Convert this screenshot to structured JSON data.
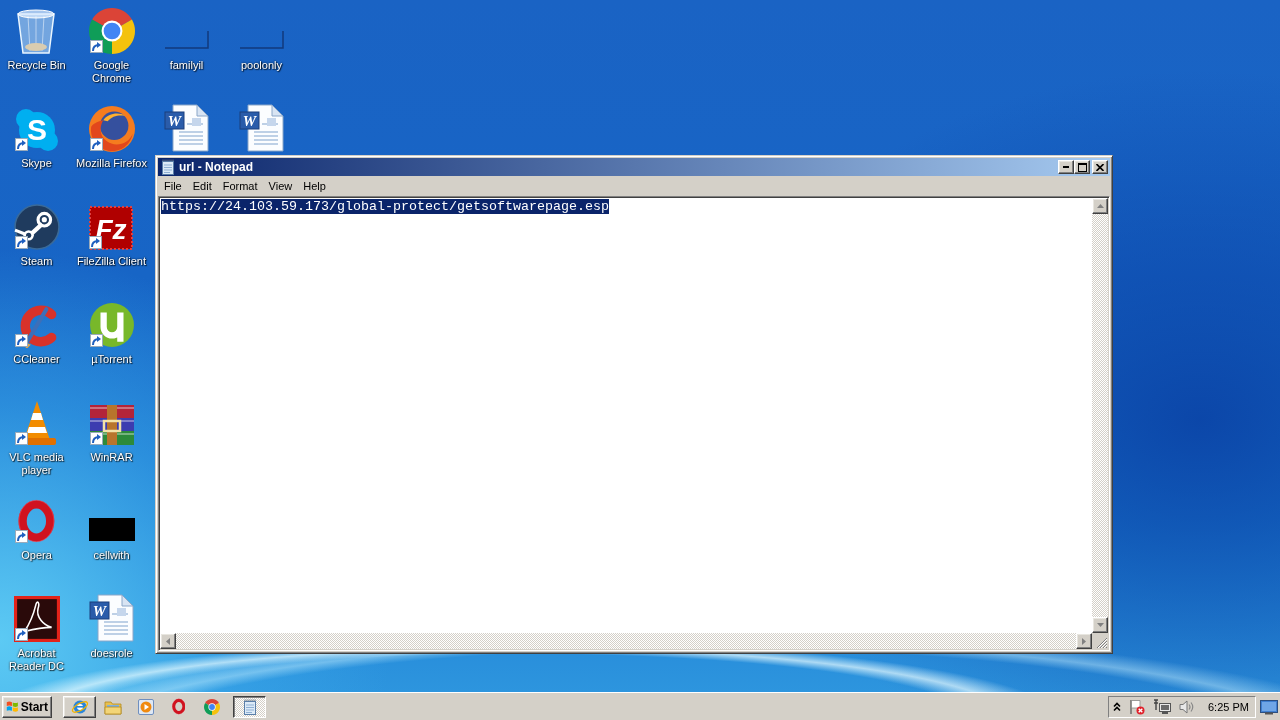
{
  "desktop": {
    "columns": [
      {
        "icons": [
          {
            "kind": "recycle-bin",
            "label": "Recycle Bin",
            "shortcut": false
          },
          {
            "kind": "skype",
            "glyph": "S",
            "label": "Skype",
            "shortcut": true
          },
          {
            "kind": "steam",
            "label": "Steam",
            "shortcut": true
          },
          {
            "kind": "ccleaner",
            "label": "CCleaner",
            "shortcut": true
          },
          {
            "kind": "vlc",
            "label": "VLC media player",
            "shortcut": true
          },
          {
            "kind": "opera",
            "label": "Opera",
            "shortcut": true
          },
          {
            "kind": "acrobat",
            "label": "Acrobat Reader DC",
            "shortcut": true
          }
        ]
      },
      {
        "icons": [
          {
            "kind": "chrome",
            "label": "Google Chrome",
            "shortcut": true
          },
          {
            "kind": "firefox",
            "label": "Mozilla Firefox",
            "shortcut": true
          },
          {
            "kind": "filezilla",
            "glyph": "Fz",
            "label": "FileZilla Client",
            "shortcut": true
          },
          {
            "kind": "utorrent",
            "label": "µTorrent",
            "shortcut": true
          },
          {
            "kind": "winrar",
            "label": "WinRAR",
            "shortcut": true
          },
          {
            "kind": "thumbnail",
            "label": "cellwith",
            "shortcut": false
          },
          {
            "kind": "word-doc",
            "glyph": "W",
            "label": "doesrole",
            "shortcut": false
          }
        ]
      },
      {
        "icons": [
          {
            "kind": "blank",
            "label": "familyil",
            "shortcut": false
          },
          {
            "kind": "word-doc",
            "glyph": "W",
            "shortcut": false
          }
        ]
      },
      {
        "icons": [
          {
            "kind": "blank",
            "label": "poolonly",
            "shortcut": false
          },
          {
            "kind": "word-doc",
            "glyph": "W",
            "shortcut": false
          }
        ]
      }
    ]
  },
  "window": {
    "title": "url - Notepad",
    "menu": [
      "File",
      "Edit",
      "Format",
      "View",
      "Help"
    ],
    "editor": {
      "text": "https://24.103.59.173/global-protect/getsoftwarepage.esp",
      "selected": true
    }
  },
  "taskbar": {
    "start": "Start",
    "quick_launch": [
      {
        "kind": "ie",
        "highlighted": true
      },
      {
        "kind": "explorer",
        "highlighted": false
      },
      {
        "kind": "media-player",
        "highlighted": false
      },
      {
        "kind": "opera",
        "highlighted": false
      },
      {
        "kind": "chrome",
        "highlighted": false
      }
    ],
    "tasks": [
      {
        "kind": "notepad",
        "selected": true
      }
    ],
    "tray": {
      "icons": [
        {
          "kind": "overflow"
        },
        {
          "kind": "flag-alert"
        },
        {
          "kind": "network"
        },
        {
          "kind": "volume"
        }
      ],
      "clock": "6:25 PM"
    }
  }
}
